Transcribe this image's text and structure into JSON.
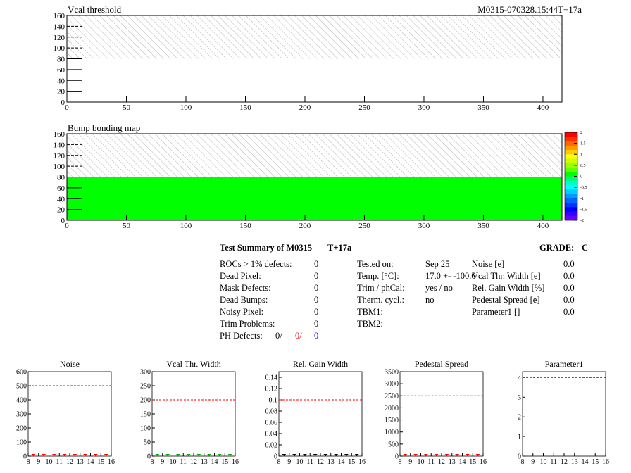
{
  "header": {
    "plot1_title": "Vcal threshold",
    "module_id": "M0315-070328.15:44T+17a",
    "plot2_title": "Bump bonding map"
  },
  "maps": {
    "x_ticks": [
      "0",
      "50",
      "100",
      "150",
      "200",
      "250",
      "300",
      "350",
      "400"
    ],
    "y_ticks": [
      "0",
      "20",
      "40",
      "60",
      "80",
      "100",
      "120",
      "140",
      "160"
    ],
    "xlim": [
      0,
      416
    ],
    "ylim": [
      0,
      160
    ],
    "filled_rows_top": 80,
    "bump_fill_color": "#00ff00",
    "hatch_color": "#b4b4b4"
  },
  "colorbar": {
    "labels": [
      "2",
      "1.5",
      "1",
      "0.5",
      "0",
      "-0.5",
      "-1",
      "-1.5",
      "-2"
    ],
    "colors": [
      "#ff0000",
      "#ff3300",
      "#ff6600",
      "#ff9900",
      "#ffcc00",
      "#ffff00",
      "#ccff00",
      "#99ff00",
      "#66ff00",
      "#00ff00",
      "#00ff66",
      "#00ffcc",
      "#00ffff",
      "#00ccff",
      "#0099ff",
      "#0066ff",
      "#0033ff",
      "#0000ff",
      "#3300ff",
      "#6600ff"
    ]
  },
  "summary": {
    "title": "Test Summary of M0315",
    "tag": "T+17a",
    "grade_label": "GRADE:",
    "grade": "C",
    "left": [
      {
        "label": "ROCs > 1% defects:",
        "value": "0"
      },
      {
        "label": "Dead Pixel:",
        "value": "0"
      },
      {
        "label": "Mask Defects:",
        "value": "0"
      },
      {
        "label": "Dead Bumps:",
        "value": "0"
      },
      {
        "label": "Noisy Pixel:",
        "value": "0"
      },
      {
        "label": "Trim Problems:",
        "value": "0"
      }
    ],
    "ph_label": "PH Defects:",
    "ph_values": [
      {
        "value": "0/",
        "color": "#000000"
      },
      {
        "value": "0/",
        "color": "#ff0000"
      },
      {
        "value": "0",
        "color": "#0000ff"
      }
    ],
    "middle": [
      {
        "label": "Tested on:",
        "value": "Sep 25"
      },
      {
        "label": "Temp. [°C]:",
        "value": "17.0 +- -100.0"
      },
      {
        "label": "Trim / phCal:",
        "value": "yes / no"
      },
      {
        "label": "Therm. cycl.:",
        "value": "no"
      },
      {
        "label": "TBM1:",
        "value": ""
      },
      {
        "label": "TBM2:",
        "value": ""
      }
    ],
    "right": [
      {
        "label": "Noise [e]",
        "value": "0.0"
      },
      {
        "label": "Vcal Thr. Width [e]",
        "value": "0.0"
      },
      {
        "label": "Rel. Gain Width [%]",
        "value": "0.0"
      },
      {
        "label": "Pedestal Spread [e]",
        "value": "0.0"
      },
      {
        "label": "Parameter1 []",
        "value": "0.0"
      }
    ]
  },
  "chart_data": [
    {
      "type": "scatter",
      "title": "Noise",
      "xlim": [
        8,
        16
      ],
      "ylim": [
        0,
        600
      ],
      "x_ticks": [
        "8",
        "9",
        "10",
        "11",
        "12",
        "13",
        "14",
        "15",
        "16"
      ],
      "y_ticks": [
        "0",
        "100",
        "200",
        "300",
        "400",
        "500",
        "600"
      ],
      "limit": 500,
      "limit_color": "#ff0000",
      "marker_color": "#ff0000",
      "x": [
        8.5,
        9.5,
        10.5,
        11.5,
        12.5,
        13.5,
        14.5,
        15.5
      ],
      "y": [
        0,
        0,
        0,
        0,
        0,
        0,
        0,
        0
      ]
    },
    {
      "type": "scatter",
      "title": "Vcal Thr. Width",
      "xlim": [
        8,
        16
      ],
      "ylim": [
        0,
        300
      ],
      "x_ticks": [
        "8",
        "9",
        "10",
        "11",
        "12",
        "13",
        "14",
        "15",
        "16"
      ],
      "y_ticks": [
        "0",
        "50",
        "100",
        "150",
        "200",
        "250",
        "300"
      ],
      "limit": 200,
      "limit_color": "#ff0000",
      "marker_color": "#00aa00",
      "x": [
        8.5,
        9.5,
        10.5,
        11.5,
        12.5,
        13.5,
        14.5,
        15.5
      ],
      "y": [
        0,
        0,
        0,
        0,
        0,
        0,
        0,
        0
      ]
    },
    {
      "type": "scatter",
      "title": "Rel. Gain Width",
      "xlim": [
        8,
        16
      ],
      "ylim": [
        0,
        0.15
      ],
      "x_ticks": [
        "8",
        "9",
        "10",
        "11",
        "12",
        "13",
        "14",
        "15",
        "16"
      ],
      "y_ticks": [
        "0",
        "0.02",
        "0.04",
        "0.06",
        "0.08",
        "0.1",
        "0.12",
        "0.14"
      ],
      "limit": 0.1,
      "limit_color": "#ff0000",
      "marker_color": "#000000",
      "x": [
        8.5,
        9.5,
        10.5,
        11.5,
        12.5,
        13.5,
        14.5,
        15.5
      ],
      "y": [
        0,
        0,
        0,
        0,
        0,
        0,
        0,
        0
      ]
    },
    {
      "type": "scatter",
      "title": "Pedestal Spread",
      "xlim": [
        8,
        16
      ],
      "ylim": [
        0,
        3500
      ],
      "x_ticks": [
        "8",
        "9",
        "10",
        "11",
        "12",
        "13",
        "14",
        "15",
        "16"
      ],
      "y_ticks": [
        "0",
        "500",
        "1000",
        "1500",
        "2000",
        "2500",
        "3000",
        "3500"
      ],
      "limit": 2500,
      "limit_color": "#ff0000",
      "marker_color": "#ff0000",
      "x": [
        8.5,
        9.5,
        10.5,
        11.5,
        12.5,
        13.5,
        14.5,
        15.5
      ],
      "y": [
        0,
        0,
        0,
        0,
        0,
        0,
        0,
        0
      ]
    },
    {
      "type": "scatter",
      "title": "Parameter1",
      "xlim": [
        8,
        16
      ],
      "ylim": [
        0,
        4.3
      ],
      "x_ticks": [
        "8",
        "9",
        "10",
        "11",
        "12",
        "13",
        "14",
        "15",
        "16"
      ],
      "y_ticks": [
        "0",
        "1",
        "2",
        "3",
        "4"
      ],
      "limit": 4,
      "limit_color": "#ff0000",
      "marker_color": "#000000",
      "x": [],
      "y": []
    }
  ]
}
